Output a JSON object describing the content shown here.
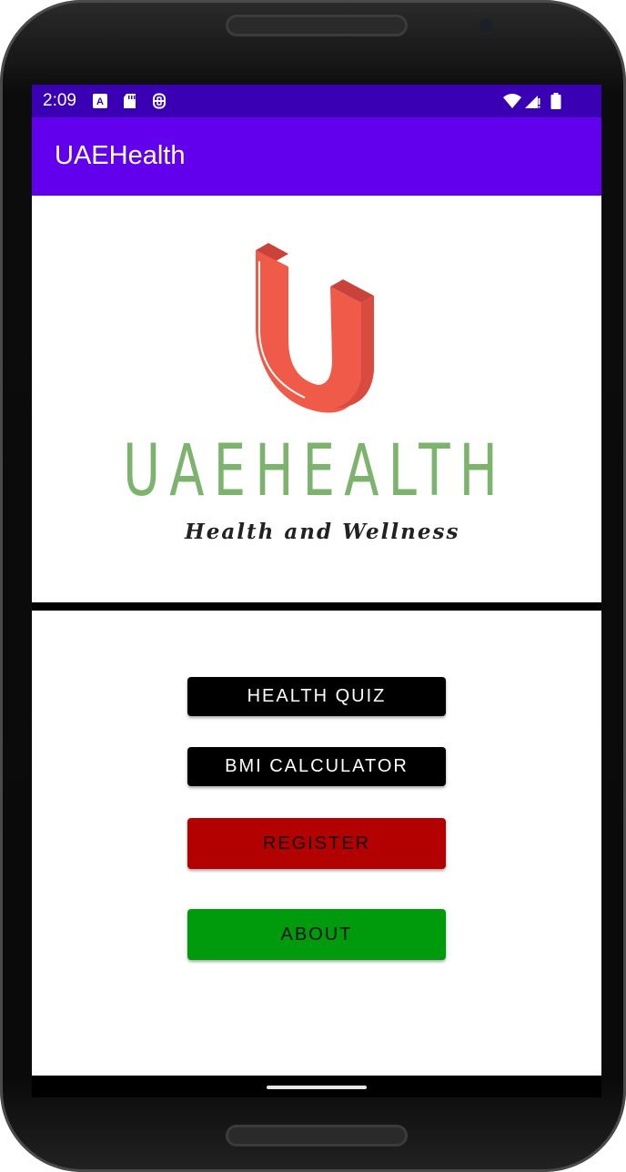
{
  "status_bar": {
    "time": "2:09",
    "left_icons": [
      "accessibility-a-icon",
      "sd-card-icon",
      "sim-circle-icon"
    ],
    "right_icons": [
      "wifi-icon",
      "signal-icon",
      "battery-icon"
    ],
    "color": "#3a01b4"
  },
  "app_bar": {
    "title": "UAEHealth",
    "color": "#6200ee"
  },
  "logo": {
    "wordmark": "UAEHEALTH",
    "tagline": "Health and Wellness",
    "mark_color": "#f05a48",
    "wordmark_color": "#7cb36d"
  },
  "buttons": {
    "health_quiz": "HEALTH QUIZ",
    "bmi_calculator": "BMI CALCULATOR",
    "register": "REGISTER",
    "about": "ABOUT"
  },
  "colors": {
    "dark_button": "#000000",
    "register": "#b30000",
    "about": "#009a0d"
  }
}
